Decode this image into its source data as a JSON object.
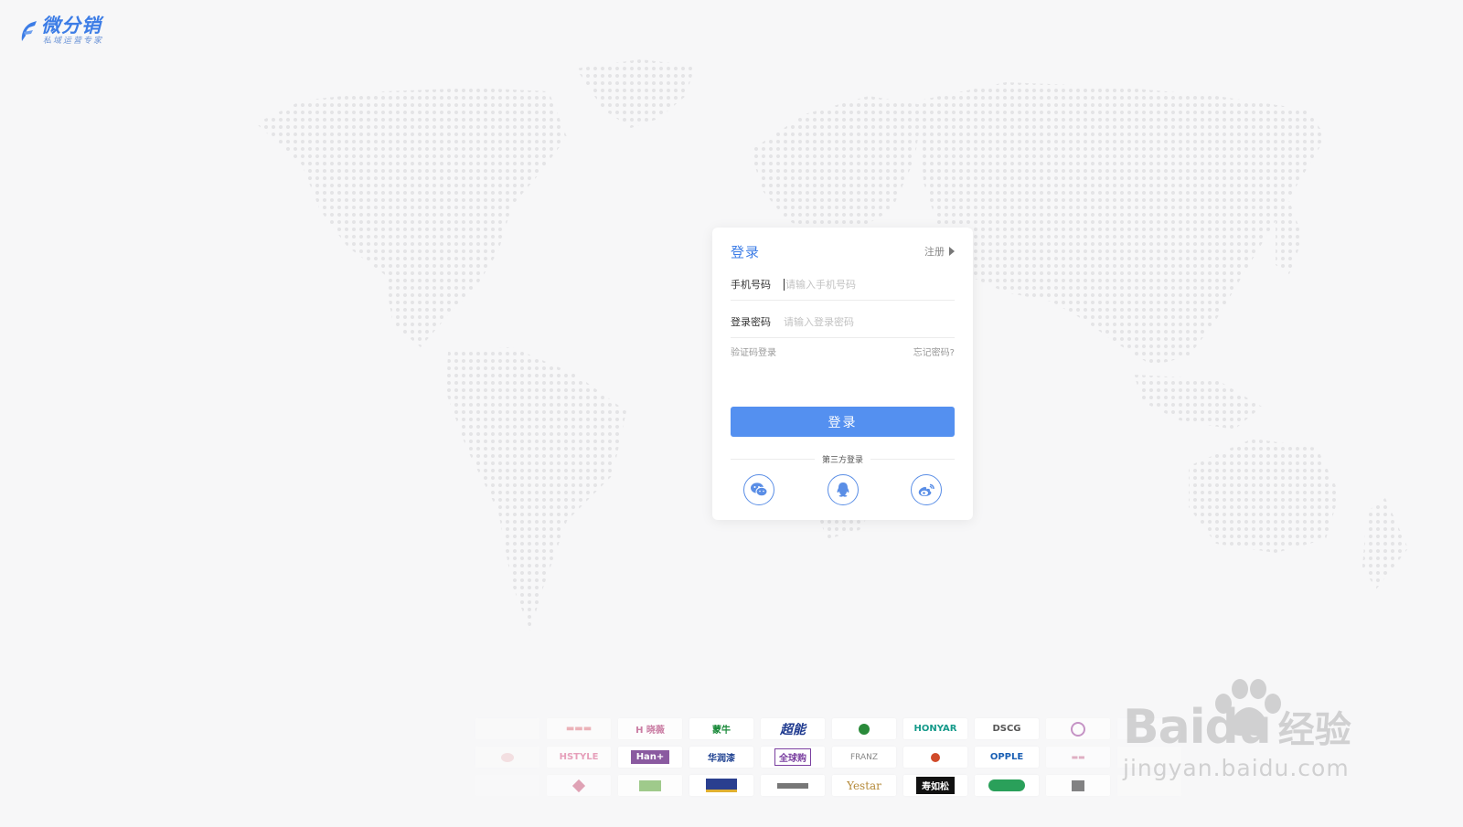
{
  "logo": {
    "name": "微分销",
    "slogan": "私域运营专家",
    "icon": "logo-mark-icon"
  },
  "login": {
    "title": "登录",
    "register_label": "注册",
    "phone_label": "手机号码",
    "phone_placeholder": "请输入手机号码",
    "password_label": "登录密码",
    "password_placeholder": "请输入登录密码",
    "code_login": "验证码登录",
    "forgot_password": "忘记密码?",
    "submit_label": "登录",
    "third_party_label": "第三方登录",
    "third_party": [
      {
        "name": "wechat",
        "icon": "wechat-icon"
      },
      {
        "name": "qq",
        "icon": "qq-icon"
      },
      {
        "name": "weibo",
        "icon": "weibo-icon"
      }
    ]
  },
  "brands": [
    [
      {
        "text": "蒙牛",
        "color": "#1a8a3a"
      },
      {
        "text": "超能",
        "color": "#1f3a8f"
      },
      {
        "text": "HONYAR",
        "color": "#159a8a"
      },
      {
        "text": "DSCG",
        "color": "#555555"
      }
    ],
    [
      {
        "text": "HSTYLE",
        "color": "#e07aa0"
      },
      {
        "text": "Han+",
        "color": "#ffffff"
      },
      {
        "text": "华润漆",
        "color": "#1a3d8f"
      },
      {
        "text": "全球购",
        "color": "#7a3fa0"
      },
      {
        "text": "FRANZ",
        "color": "#888888"
      },
      {
        "text": "OPPLE",
        "color": "#1a5fb4"
      }
    ],
    [
      {
        "text": "Yestar",
        "color": "#b58a3a"
      },
      {
        "text": "寿如松",
        "color": "#ffffff"
      }
    ]
  ],
  "watermark": {
    "brand": "Baidu",
    "brand_cn": "经验",
    "url": "jingyan.baidu.com"
  }
}
